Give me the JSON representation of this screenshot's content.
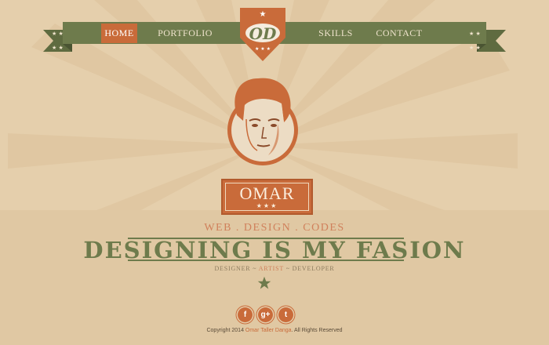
{
  "colors": {
    "background": "#e5cfac",
    "accent_orange": "#c96b3a",
    "army_green": "#6e7b4c",
    "ray": "#dcc19a"
  },
  "nav": {
    "items": [
      {
        "label": "HOME",
        "active": true
      },
      {
        "label": "PORTFOLIO",
        "active": false
      },
      {
        "label": "SKILLS",
        "active": false
      },
      {
        "label": "CONTACT",
        "active": false
      }
    ],
    "logo_text": "OD"
  },
  "profile": {
    "name": "OMAR",
    "name_stars": "★★★"
  },
  "tagline": "WEB . DESIGN . CODES",
  "headline": "DESIGNING IS MY FASION",
  "roles": {
    "first": "DESIGNER",
    "sep1": " ~ ",
    "second": "ARTIST",
    "sep2": " ~ ",
    "third": "DEVELOPER"
  },
  "social": [
    {
      "icon": "facebook-icon",
      "glyph": "f"
    },
    {
      "icon": "google-plus-icon",
      "glyph": "g+"
    },
    {
      "icon": "twitter-icon",
      "glyph": "t"
    }
  ],
  "footer": {
    "prefix": "Copyright 2014 ",
    "author": "Omar Taller Danga",
    "suffix": ". All Rights Reserved"
  }
}
